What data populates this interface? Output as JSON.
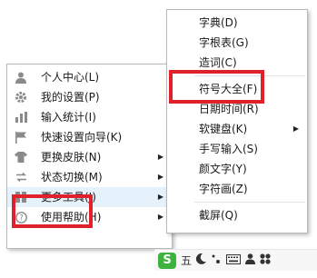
{
  "main_menu": {
    "items": [
      {
        "label": "个人中心(L)",
        "icon": "user-icon"
      },
      {
        "label": "我的设置(P)",
        "icon": "gear-icon"
      },
      {
        "label": "输入统计(I)",
        "icon": "bar-chart-icon"
      },
      {
        "label": "快速设置向导(K)",
        "icon": "flag-icon"
      },
      {
        "label": "更换皮肤(N)",
        "icon": "shirt-icon"
      },
      {
        "label": "状态切换(M)",
        "icon": "switch-icon"
      },
      {
        "label": "更多工具(J)",
        "icon": "grid-icon"
      },
      {
        "label": "使用帮助(H)",
        "icon": "help-icon"
      }
    ]
  },
  "sub_menu": {
    "items": [
      {
        "label": "字典(D)"
      },
      {
        "label": "字根表(G)"
      },
      {
        "label": "造词(C)"
      },
      {
        "label": "符号大全(F)"
      },
      {
        "label": "日期时间(R)"
      },
      {
        "label": "软键盘(K)"
      },
      {
        "label": "手写输入(S)"
      },
      {
        "label": "颜文字(Y)"
      },
      {
        "label": "字符画(Z)"
      },
      {
        "label": "截屏(Q)"
      }
    ]
  },
  "taskbar": {
    "mode_label": "五",
    "icons": [
      "sogou-logo-icon",
      "moon-icon",
      "punctuation-icon",
      "keyboard-icon",
      "person-icon",
      "clover-icon"
    ]
  },
  "colors": {
    "highlight_box": "#e0212b",
    "icon_gray": "#8a8a8a",
    "logo_green": "#3db33d"
  }
}
